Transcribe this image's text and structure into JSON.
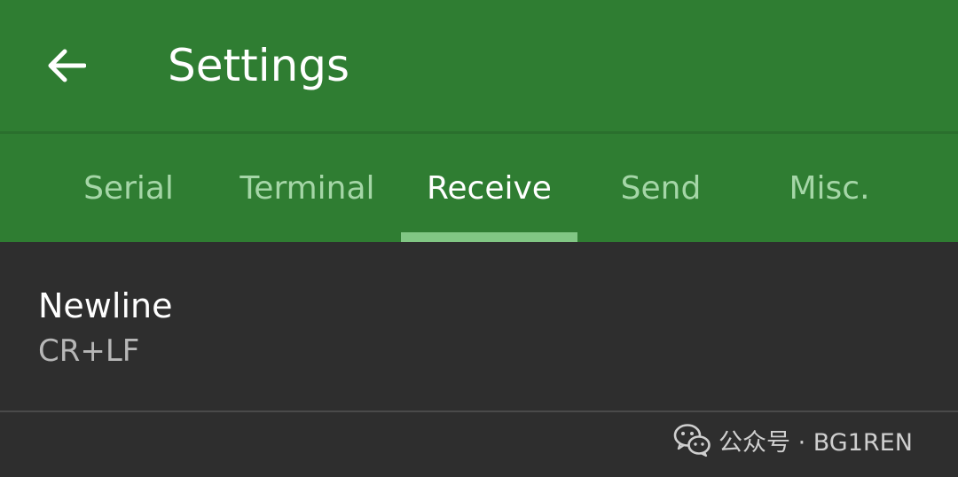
{
  "app_bar": {
    "title": "Settings",
    "back_icon": "arrow-left-icon"
  },
  "tabs": [
    {
      "label": "Serial",
      "active": false
    },
    {
      "label": "Terminal",
      "active": false
    },
    {
      "label": "Receive",
      "active": true
    },
    {
      "label": "Send",
      "active": false
    },
    {
      "label": "Misc.",
      "active": false
    }
  ],
  "preferences": [
    {
      "title": "Newline",
      "summary": "CR+LF"
    }
  ],
  "watermark": {
    "icon": "wechat-icon",
    "text": "公众号 · BG1REN"
  },
  "colors": {
    "primary": "#2f7d32",
    "tab_inactive": "#a5d6a7",
    "tab_indicator": "#81c784",
    "background": "#2e2e2e"
  }
}
